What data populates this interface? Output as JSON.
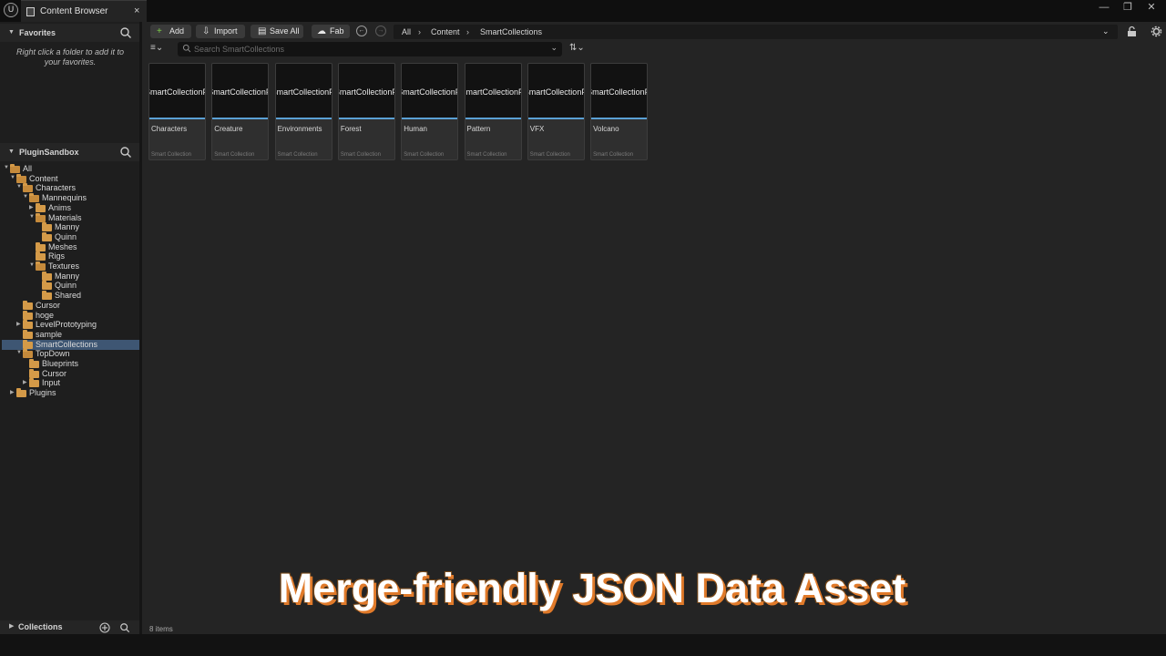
{
  "window": {
    "logo_glyph": "U",
    "tab_title": "Content Browser",
    "tab_close": "×",
    "controls": {
      "minimize": "—",
      "restore": "❐",
      "close": "✕"
    }
  },
  "favorites": {
    "title": "Favorites",
    "hint": "Right click a folder to add it to your favorites."
  },
  "project": {
    "title": "PluginSandbox"
  },
  "tree": [
    {
      "label": "All",
      "depth": 0,
      "expanded": true,
      "arrow": "▼"
    },
    {
      "label": "Content",
      "depth": 1,
      "expanded": true,
      "arrow": "▼"
    },
    {
      "label": "Characters",
      "depth": 2,
      "expanded": true,
      "arrow": "▼"
    },
    {
      "label": "Mannequins",
      "depth": 3,
      "expanded": true,
      "arrow": "▼"
    },
    {
      "label": "Anims",
      "depth": 4,
      "expanded": false,
      "arrow": "▶"
    },
    {
      "label": "Materials",
      "depth": 4,
      "expanded": true,
      "arrow": "▼"
    },
    {
      "label": "Manny",
      "depth": 5,
      "expanded": false,
      "arrow": ""
    },
    {
      "label": "Quinn",
      "depth": 5,
      "expanded": false,
      "arrow": ""
    },
    {
      "label": "Meshes",
      "depth": 4,
      "expanded": false,
      "arrow": ""
    },
    {
      "label": "Rigs",
      "depth": 4,
      "expanded": false,
      "arrow": ""
    },
    {
      "label": "Textures",
      "depth": 4,
      "expanded": true,
      "arrow": "▼"
    },
    {
      "label": "Manny",
      "depth": 5,
      "expanded": false,
      "arrow": ""
    },
    {
      "label": "Quinn",
      "depth": 5,
      "expanded": false,
      "arrow": ""
    },
    {
      "label": "Shared",
      "depth": 5,
      "expanded": false,
      "arrow": ""
    },
    {
      "label": "Cursor",
      "depth": 2,
      "expanded": false,
      "arrow": ""
    },
    {
      "label": "hoge",
      "depth": 2,
      "expanded": false,
      "arrow": ""
    },
    {
      "label": "LevelPrototyping",
      "depth": 2,
      "expanded": false,
      "arrow": "▶"
    },
    {
      "label": "sample",
      "depth": 2,
      "expanded": false,
      "arrow": ""
    },
    {
      "label": "SmartCollections",
      "depth": 2,
      "expanded": false,
      "arrow": "",
      "selected": true
    },
    {
      "label": "TopDown",
      "depth": 2,
      "expanded": true,
      "arrow": "▼"
    },
    {
      "label": "Blueprints",
      "depth": 3,
      "expanded": false,
      "arrow": ""
    },
    {
      "label": "Cursor",
      "depth": 3,
      "expanded": false,
      "arrow": ""
    },
    {
      "label": "Input",
      "depth": 3,
      "expanded": false,
      "arrow": "▶"
    },
    {
      "label": "Plugins",
      "depth": 1,
      "expanded": false,
      "arrow": "▶"
    }
  ],
  "collections": {
    "title": "Collections"
  },
  "toolbar": {
    "add": "Add",
    "import": "Import",
    "save_all": "Save All",
    "fab": "Fab",
    "back_icon": "←",
    "forward_icon": "→"
  },
  "breadcrumb": [
    "All",
    "Content",
    "SmartCollections"
  ],
  "breadcrumb_sep": "›",
  "search": {
    "placeholder": "Search SmartCollections",
    "value": ""
  },
  "assets": [
    {
      "thumb": "SmartCollectionF",
      "name": "Characters",
      "type": "Smart Collection"
    },
    {
      "thumb": "SmartCollectionF",
      "name": "Creature",
      "type": "Smart Collection"
    },
    {
      "thumb": "SmartCollectionF",
      "name": "Environments",
      "type": "Smart Collection"
    },
    {
      "thumb": "SmartCollectionF",
      "name": "Forest",
      "type": "Smart Collection"
    },
    {
      "thumb": "SmartCollectionF",
      "name": "Human",
      "type": "Smart Collection"
    },
    {
      "thumb": "SmartCollectionF",
      "name": "Pattern",
      "type": "Smart Collection"
    },
    {
      "thumb": "SmartCollectionF",
      "name": "VFX",
      "type": "Smart Collection"
    },
    {
      "thumb": "SmartCollectionF",
      "name": "Volcano",
      "type": "Smart Collection"
    }
  ],
  "status": {
    "item_count": "8 items"
  },
  "overlay_caption": "Merge-friendly JSON Data Asset",
  "colors": {
    "selection": "#3e5673",
    "folder": "#d49a48",
    "thumb_accent": "#5aa0d4",
    "caption_shadow": "#e07a2a"
  }
}
